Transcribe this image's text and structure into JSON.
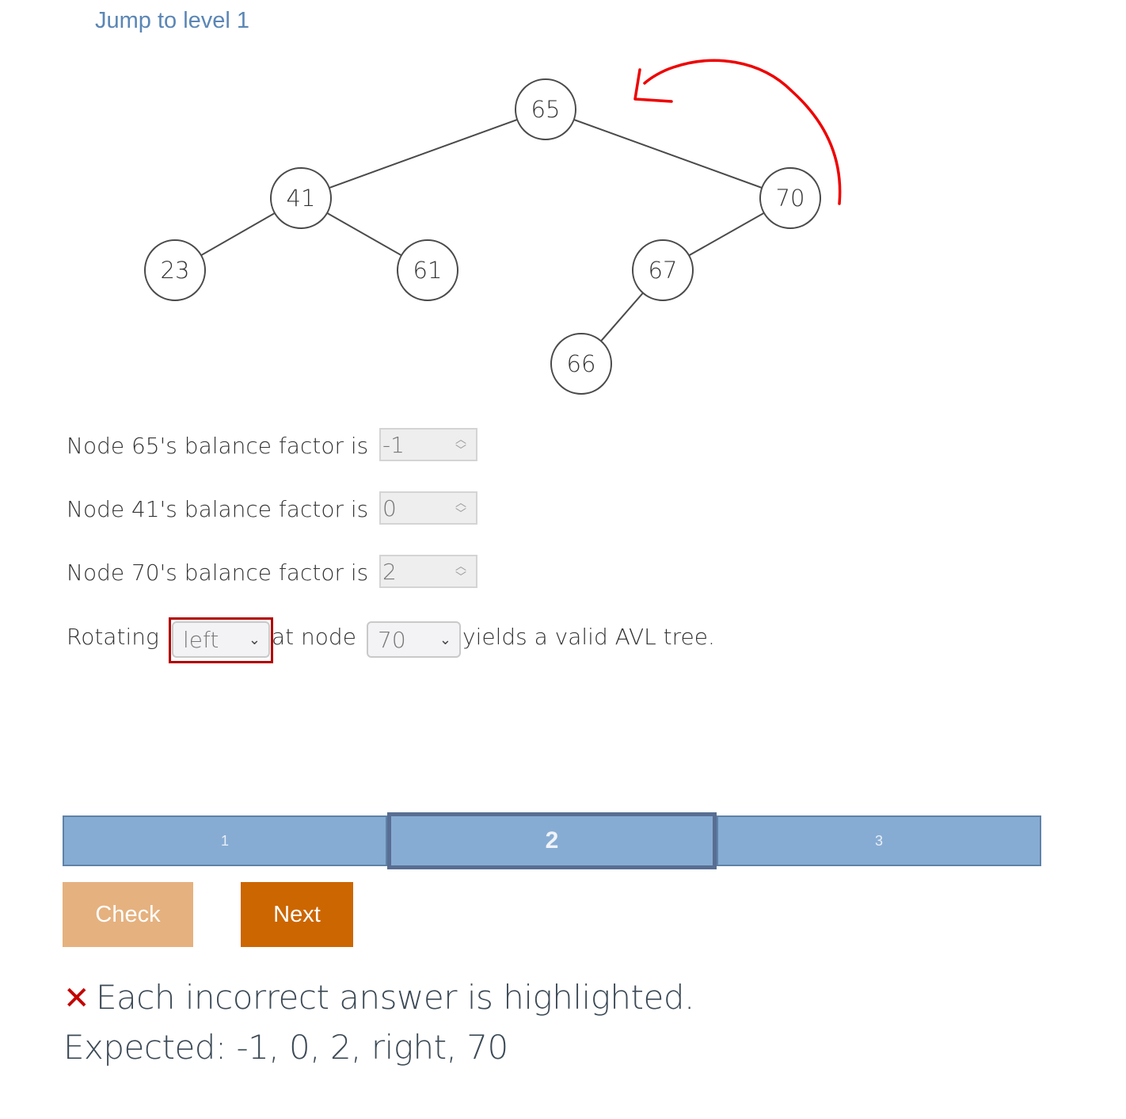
{
  "header": {
    "jump_link": "Jump to level 1"
  },
  "tree": {
    "nodes": [
      {
        "id": "65",
        "label": "65"
      },
      {
        "id": "41",
        "label": "41"
      },
      {
        "id": "70",
        "label": "70"
      },
      {
        "id": "23",
        "label": "23"
      },
      {
        "id": "61",
        "label": "61"
      },
      {
        "id": "67",
        "label": "67"
      },
      {
        "id": "66",
        "label": "66"
      }
    ],
    "edges": [
      [
        "65",
        "41"
      ],
      [
        "65",
        "70"
      ],
      [
        "41",
        "23"
      ],
      [
        "41",
        "61"
      ],
      [
        "70",
        "67"
      ],
      [
        "67",
        "66"
      ]
    ],
    "annotation": "red-rotation-arrow"
  },
  "questions": [
    {
      "label": "Node 65's balance factor is",
      "value": "-1"
    },
    {
      "label": "Node 41's balance factor is",
      "value": "0"
    },
    {
      "label": "Node 70's balance factor is",
      "value": "2"
    }
  ],
  "rotation": {
    "prefix": "Rotating",
    "direction_value": "left",
    "middle": "at node",
    "node_value": "70",
    "suffix": "yields a valid AVL tree."
  },
  "progress": {
    "segments": [
      "1",
      "2",
      "3"
    ],
    "current": "2"
  },
  "buttons": {
    "check": "Check",
    "next": "Next"
  },
  "feedback": {
    "icon": "✕",
    "message": "Each incorrect answer is highlighted.",
    "expected": "Expected: -1, 0, 2, right, 70"
  },
  "colors": {
    "link": "#5a86b5",
    "error": "#b30000",
    "progress_fill": "#87acd3",
    "check_button": "#e5b17f",
    "next_button": "#cc6600"
  }
}
